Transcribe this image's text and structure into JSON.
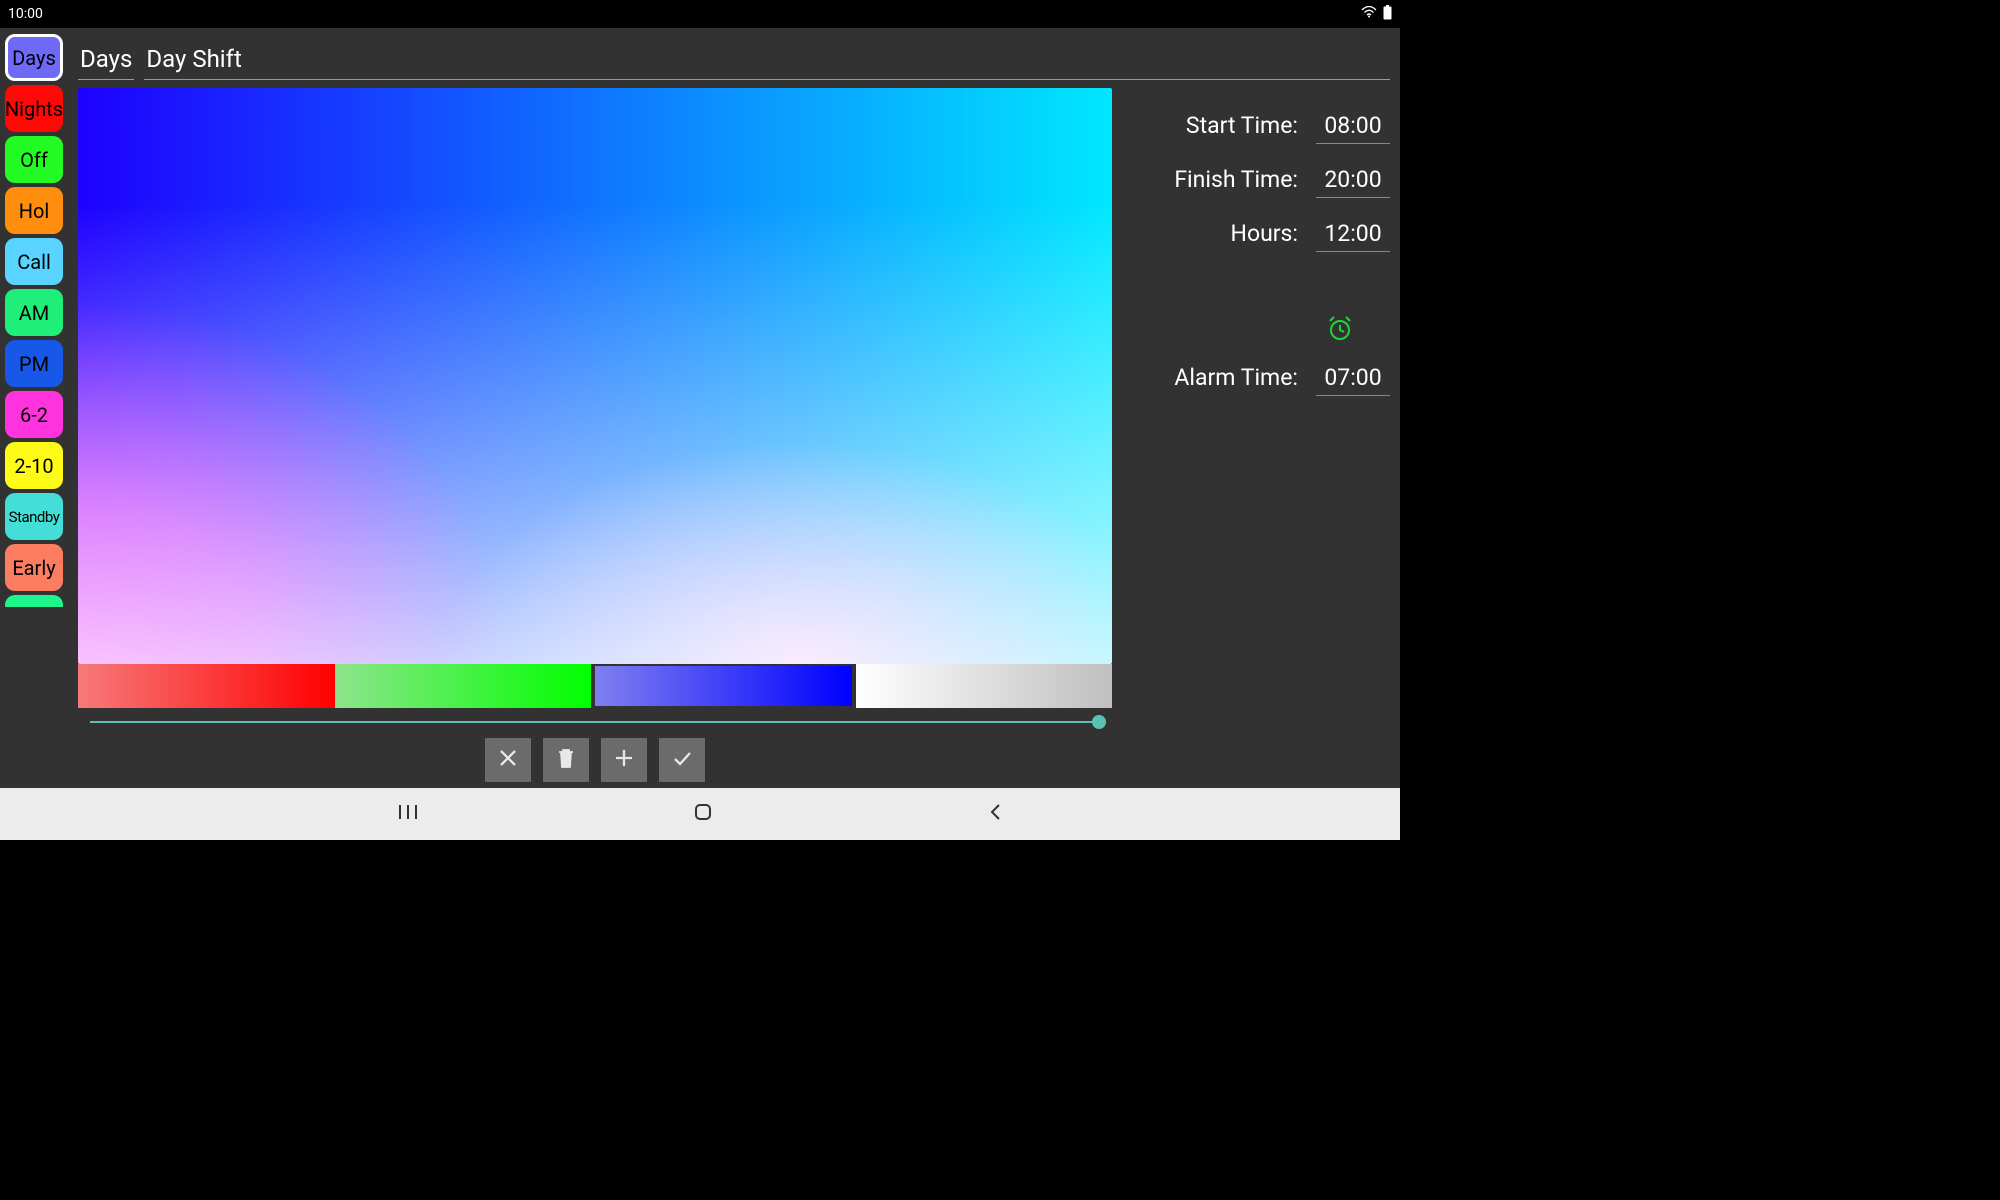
{
  "status": {
    "time": "10:00"
  },
  "sidebar": {
    "items": [
      {
        "label": "Days",
        "class": "pill-days",
        "selected": true
      },
      {
        "label": "Nights",
        "class": "pill-nights",
        "selected": false
      },
      {
        "label": "Off",
        "class": "pill-off",
        "selected": false
      },
      {
        "label": "Hol",
        "class": "pill-hol",
        "selected": false
      },
      {
        "label": "Call",
        "class": "pill-call",
        "selected": false
      },
      {
        "label": "AM",
        "class": "pill-am",
        "selected": false
      },
      {
        "label": "PM",
        "class": "pill-pm",
        "selected": false
      },
      {
        "label": "6-2",
        "class": "pill-62",
        "selected": false
      },
      {
        "label": "2-10",
        "class": "pill-210",
        "selected": false
      },
      {
        "label": "Standby",
        "class": "pill-stdby",
        "selected": false
      },
      {
        "label": "Early",
        "class": "pill-early",
        "selected": false
      }
    ]
  },
  "header": {
    "short_name": "Days",
    "long_name": "Day Shift"
  },
  "times": {
    "start_label": "Start Time:",
    "start_value": "08:00",
    "finish_label": "Finish Time:",
    "finish_value": "20:00",
    "hours_label": "Hours:",
    "hours_value": "12:00",
    "alarm_label": "Alarm Time:",
    "alarm_value": "07:00"
  },
  "color_picker": {
    "selected_channel": "blue",
    "slider_position": 1.0
  }
}
